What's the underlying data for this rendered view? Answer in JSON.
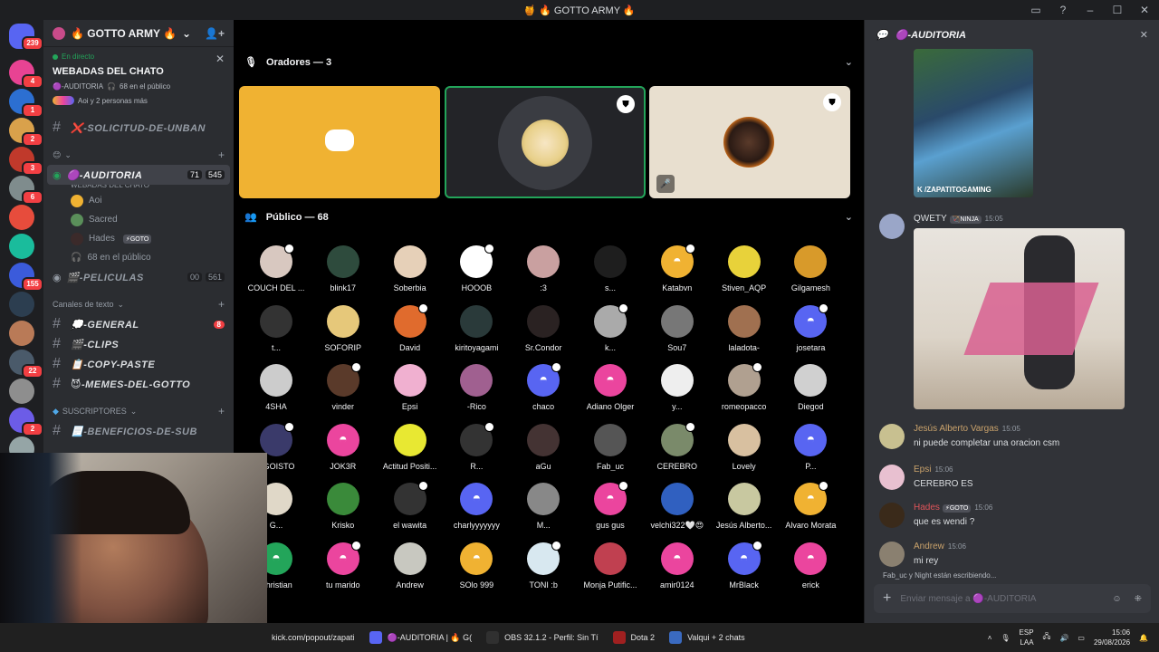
{
  "window": {
    "title": "🍯 🔥 GOTTO ARMY 🔥"
  },
  "rail": {
    "home_badge": "239",
    "servers": [
      {
        "color": "#e84393",
        "badge": "4"
      },
      {
        "color": "#2c6fd1",
        "badge": "1"
      },
      {
        "color": "#d9a14b",
        "badge": "2"
      },
      {
        "color": "#c0392b",
        "badge": "3"
      },
      {
        "color": "#7f8c8d",
        "badge": "6"
      },
      {
        "color": "#e74c3c",
        "badge": ""
      },
      {
        "color": "#1abc9c",
        "badge": ""
      },
      {
        "color": "#3b5bdb",
        "badge": "155"
      },
      {
        "color": "#2c3e50",
        "badge": ""
      },
      {
        "color": "#b97a57",
        "badge": ""
      },
      {
        "color": "#4a5a6a",
        "badge": "22"
      },
      {
        "color": "#8e8e8e",
        "badge": ""
      },
      {
        "color": "#6c5ce7",
        "badge": "2"
      },
      {
        "color": "#95a5a6",
        "badge": ""
      }
    ]
  },
  "sidebar": {
    "server_name": "🔥 GOTTO ARMY 🔥",
    "live_tag": "En directo",
    "event_name": "WEBADAS DEL CHATO",
    "event_channel": "🟣-AUDITORIA",
    "event_public": "68 en el público",
    "event_people": "Aoi y 2 personas más",
    "channels": [
      {
        "name": "❌-SOLICITUD-DE-UNBAN"
      }
    ],
    "voice_active": {
      "name": "🟣-AUDITORIA",
      "count1": "71",
      "count2": "545",
      "subtitle": "WEBADAS DEL CHATO"
    },
    "voice_users": [
      {
        "name": "Aoi",
        "color": "#f0b232"
      },
      {
        "name": "Sacred",
        "color": "#5a8f5a"
      },
      {
        "name": "Hades",
        "chip": "⚡GOTO",
        "color": "#3b2a2a"
      }
    ],
    "public_count": "68 en el público",
    "voice2": {
      "name": "🎬-PELICULAS",
      "count1": "00",
      "count2": "561"
    },
    "cat_text": "Canales de texto",
    "text_channels": [
      {
        "name": "💭-GENERAL",
        "badge": "8"
      },
      {
        "name": "🎬-CLIPS",
        "badge": ""
      },
      {
        "name": "📋-COPY-PASTE",
        "badge": ""
      },
      {
        "name": "😈-MEMES-DEL-GOTTO",
        "badge": ""
      }
    ],
    "cat_subs": "SUSCRIPTORES",
    "sub_channels": [
      {
        "name": "📃-BENEFICIOS-DE-SUB"
      }
    ]
  },
  "stage": {
    "speakers_label": "Oradores — 3",
    "public_label": "Público — 68",
    "audience": [
      [
        "COUCH DEL ...",
        "blink17",
        "Soberbia",
        "HOOOB",
        ":3",
        "s...",
        "Katabvn",
        "Stiven_AQP",
        "Gilgamesh"
      ],
      [
        "t...",
        "SOFORIP",
        "David",
        "kiritoyagami",
        "Sr.Condor",
        "k...",
        "Sou7",
        "laladota-",
        "josetara"
      ],
      [
        "4SHA",
        "vinder",
        "Epsi",
        "-Rico",
        "chaco",
        "Adiano Olger",
        "y...",
        "romeopacco",
        "Diegod"
      ],
      [
        "EGOISTO",
        "JOK3R",
        "Actitud Positi...",
        "R...",
        "aGu",
        "Fab_uc",
        "CEREBRO",
        "Lovely",
        "P..."
      ],
      [
        "G...",
        "Krisko",
        "el wawita",
        "charlyyyyyyy",
        "M...",
        "gus gus",
        "velchi322🤍😍",
        "Jesús Alberto...",
        "Alvaro Morata"
      ],
      [
        "Christian",
        "tu marido",
        "Andrew",
        "SOlo 999",
        "TONI :b",
        "Monja Putific...",
        "amir0124",
        "MrBlack",
        "erick"
      ]
    ],
    "audience_colors": [
      [
        "#d8c8c0",
        "#2e4b3d",
        "#e6d0b8",
        "#ffffff",
        "#c9a0a0",
        "#1e1e1e",
        "#f0b232",
        "#e8d23a",
        "#d89a2a"
      ],
      [
        "#333333",
        "#e6c87a",
        "#e06b2d",
        "#2a3a3a",
        "#2a2222",
        "#aaaaaa",
        "#777777",
        "#a07050",
        "#5865f2"
      ],
      [
        "#cccccc",
        "#5a3a2a",
        "#f0b0d0",
        "#a06090",
        "#5865f2",
        "#eb459e",
        "#eeeeee",
        "#b0a090",
        "#d0d0d0"
      ],
      [
        "#3a3a6a",
        "#eb459e",
        "#e8e832",
        "#333333",
        "#443333",
        "#555555",
        "#7a8a6a",
        "#d8c0a0",
        "#5865f2"
      ],
      [
        "#e0d8c8",
        "#3a8a3a",
        "#333333",
        "#5865f2",
        "#888888",
        "#eb459e",
        "#3060c0",
        "#c8c8a0",
        "#f0b232"
      ],
      [
        "#23a55a",
        "#eb459e",
        "#c8c8c0",
        "#f0b232",
        "#d8e8f0",
        "#c04050",
        "#eb459e",
        "#5865f2",
        "#eb459e"
      ]
    ]
  },
  "chat": {
    "channel": "🟣-AUDITORIA",
    "image_caption": "K /ZAPATITOGAMING",
    "messages": [
      {
        "author": "QWETY",
        "chip": "🏹NINJA",
        "time": "15:05",
        "text": "",
        "color": "#dbdee1"
      },
      {
        "author": "Jesús Alberto Vargas",
        "time": "15:05",
        "text": "ni puede completar una oracion csm",
        "color": "#c9a26b"
      },
      {
        "author": "Epsi",
        "time": "15:06",
        "text": "CEREBRO ES",
        "color": "#c9a26b"
      },
      {
        "author": "Hades",
        "chip": "⚡GOTO",
        "time": "15:06",
        "text": "que es wendi ?",
        "color": "#e0555a"
      },
      {
        "author": "Andrew",
        "time": "15:06",
        "text": "mi rey",
        "color": "#c9a26b"
      }
    ],
    "typing": "Fab_uc y Night están escribiendo...",
    "placeholder": "Enviar mensaje a 🟣-AUDITORIA"
  },
  "taskbar": {
    "items": [
      "kick.com/popout/zapati",
      "🟣-AUDITORIA | 🔥 G(",
      "OBS 32.1.2 - Perfil: Sin Tí",
      "Dota 2",
      "Valqui + 2 chats"
    ],
    "lang1": "ESP",
    "lang2": "LAA",
    "time": "15:06",
    "date": "29/08/2026"
  }
}
